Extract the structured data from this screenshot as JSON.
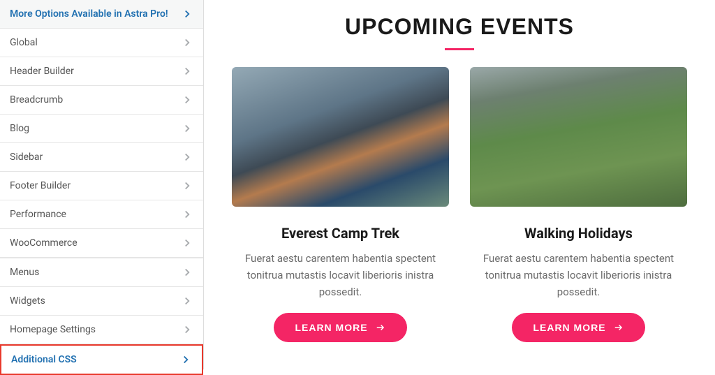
{
  "sidebar": {
    "groups": [
      {
        "items": [
          {
            "label": "More Options Available in Astra Pro!",
            "highlighted": true
          },
          {
            "label": "Global"
          },
          {
            "label": "Header Builder"
          },
          {
            "label": "Breadcrumb"
          },
          {
            "label": "Blog"
          },
          {
            "label": "Sidebar"
          },
          {
            "label": "Footer Builder"
          },
          {
            "label": "Performance"
          },
          {
            "label": "WooCommerce"
          }
        ]
      },
      {
        "items": [
          {
            "label": "Menus"
          },
          {
            "label": "Widgets"
          },
          {
            "label": "Homepage Settings"
          },
          {
            "label": "Additional CSS",
            "highlighted": true,
            "boxed": true
          }
        ]
      }
    ]
  },
  "preview": {
    "heading": "UPCOMING EVENTS",
    "cards": [
      {
        "title": "Everest Camp Trek",
        "desc": "Fuerat aestu carentem habentia spectent tonitrua mutastis locavit liberioris inistra possedit.",
        "button": "LEARN MORE"
      },
      {
        "title": "Walking Holidays",
        "desc": "Fuerat aestu carentem habentia spectent tonitrua mutastis locavit liberioris inistra possedit.",
        "button": "LEARN MORE"
      }
    ]
  }
}
